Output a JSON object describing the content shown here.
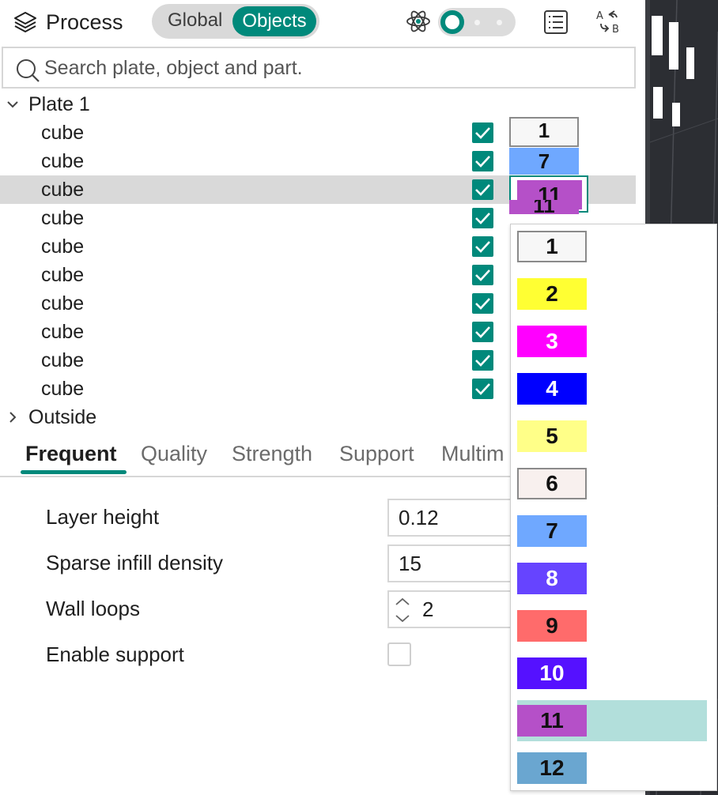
{
  "header": {
    "title": "Process",
    "mode_global": "Global",
    "mode_objects": "Objects",
    "active_mode": "Objects",
    "advanced_toggle_on": true
  },
  "search": {
    "placeholder": "Search plate, object and part."
  },
  "tree": {
    "plate_label": "Plate 1",
    "outside_label": "Outside",
    "objects": [
      {
        "name": "cube",
        "checked": true,
        "extruder": "1",
        "color": "#f7f7f7"
      },
      {
        "name": "cube",
        "checked": true,
        "extruder": "7",
        "color": "#6fa8ff"
      },
      {
        "name": "cube",
        "checked": true,
        "extruder": "11",
        "color": "#b550c8",
        "selected": true
      },
      {
        "name": "cube",
        "checked": true,
        "extruder": "11",
        "color": "#b550c8"
      },
      {
        "name": "cube",
        "checked": true
      },
      {
        "name": "cube",
        "checked": true
      },
      {
        "name": "cube",
        "checked": true
      },
      {
        "name": "cube",
        "checked": true
      },
      {
        "name": "cube",
        "checked": true
      },
      {
        "name": "cube",
        "checked": true
      }
    ]
  },
  "tabs": [
    {
      "label": "Frequent",
      "active": true
    },
    {
      "label": "Quality"
    },
    {
      "label": "Strength"
    },
    {
      "label": "Support"
    },
    {
      "label": "Multim"
    }
  ],
  "settings": {
    "layer_height_label": "Layer height",
    "layer_height_value": "0.12",
    "sparse_infill_label": "Sparse infill density",
    "sparse_infill_value": "15",
    "wall_loops_label": "Wall loops",
    "wall_loops_value": "2",
    "enable_support_label": "Enable support",
    "enable_support_checked": false
  },
  "extruder_dropdown": {
    "selected": "11",
    "options": [
      {
        "label": "1",
        "color": "#f7f7f7",
        "text_color": "#111111",
        "bordered": true
      },
      {
        "label": "2",
        "color": "#ffff33",
        "text_color": "#111111"
      },
      {
        "label": "3",
        "color": "#ff00ff",
        "text_color": "#ffffff"
      },
      {
        "label": "4",
        "color": "#0000ff",
        "text_color": "#ffffff"
      },
      {
        "label": "5",
        "color": "#ffff88",
        "text_color": "#111111"
      },
      {
        "label": "6",
        "color": "#f8f0ee",
        "text_color": "#111111",
        "bordered": true
      },
      {
        "label": "7",
        "color": "#6fa8ff",
        "text_color": "#111111"
      },
      {
        "label": "8",
        "color": "#6644ff",
        "text_color": "#ffffff"
      },
      {
        "label": "9",
        "color": "#ff6b6b",
        "text_color": "#111111"
      },
      {
        "label": "10",
        "color": "#5511ff",
        "text_color": "#ffffff"
      },
      {
        "label": "11",
        "color": "#b550c8",
        "text_color": "#111111",
        "highlight": true
      },
      {
        "label": "12",
        "color": "#6aa6d0",
        "text_color": "#111111"
      }
    ]
  },
  "colors": {
    "accent": "#00897b",
    "selection_row": "#d9d9d9",
    "dropdown_highlight": "#b2dfdb",
    "viewport_bg": "#2c2e33"
  }
}
